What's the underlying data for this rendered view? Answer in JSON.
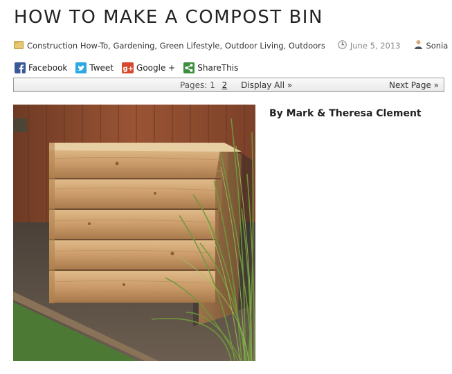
{
  "post": {
    "title": "HOW TO MAKE A COMPOST BIN",
    "categories": "Construction How-To, Gardening, Green Lifestyle, Outdoor Living, Outdoors",
    "date": "June 5, 2013",
    "author": "Sonia",
    "byline": "By Mark & Theresa Clement"
  },
  "share": {
    "facebook": "Facebook",
    "tweet": "Tweet",
    "google": "Google +",
    "sharethis": "ShareThis"
  },
  "pager": {
    "pages_label": "Pages:",
    "page1": "1",
    "page2": "2",
    "display_all": "Display All »",
    "next": "Next Page »"
  },
  "colors": {
    "facebook": "#3b5998",
    "twitter": "#2ba9e1",
    "google": "#d6492f",
    "sharethis": "#3c8f3d",
    "wall": "#8a4a2e",
    "cedar": "#c79a68"
  },
  "icons": [
    "folder-icon",
    "clock-icon",
    "person-icon",
    "facebook-icon",
    "twitter-icon",
    "google-plus-icon",
    "sharethis-icon"
  ]
}
